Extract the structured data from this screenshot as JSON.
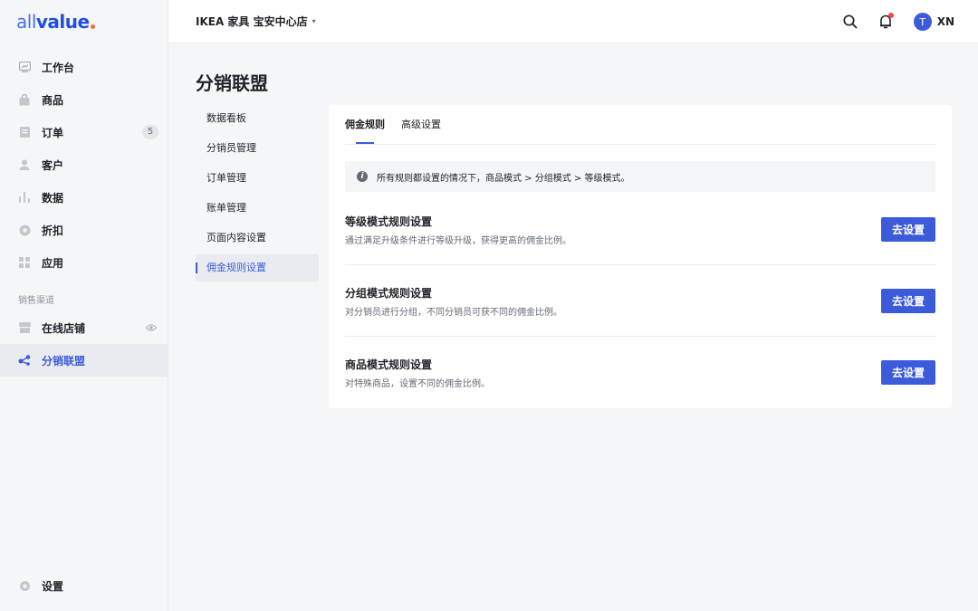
{
  "logo": {
    "part1": "all",
    "part2": "value"
  },
  "header": {
    "store_name": "IKEA 家具 宝安中心店",
    "store_caret": "▾",
    "user_initial": "T",
    "user_name": "XN"
  },
  "sidebar": {
    "items": [
      {
        "label": "工作台",
        "icon": "dashboard-icon"
      },
      {
        "label": "商品",
        "icon": "bag-icon"
      },
      {
        "label": "订单",
        "icon": "order-icon",
        "badge": "5"
      },
      {
        "label": "客户",
        "icon": "user-icon"
      },
      {
        "label": "数据",
        "icon": "chart-icon"
      },
      {
        "label": "折扣",
        "icon": "discount-icon"
      },
      {
        "label": "应用",
        "icon": "apps-icon"
      }
    ],
    "section_label": "销售渠道",
    "channels": [
      {
        "label": "在线店铺",
        "icon": "store-icon"
      },
      {
        "label": "分销联盟",
        "icon": "share-icon"
      }
    ],
    "settings_label": "设置"
  },
  "page": {
    "title": "分销联盟",
    "subnav": [
      "数据看板",
      "分销员管理",
      "订单管理",
      "账单管理",
      "页面内容设置",
      "佣金规则设置"
    ],
    "active_subnav": 5
  },
  "card": {
    "tabs": [
      "佣金规则",
      "高级设置"
    ],
    "notice": "所有规则都设置的情况下，商品模式 > 分组模式 > 等级模式。",
    "rules": [
      {
        "title": "等级模式规则设置",
        "desc": "通过满足升级条件进行等级升级，获得更高的佣金比例。",
        "button": "去设置"
      },
      {
        "title": "分组模式规则设置",
        "desc": "对分销员进行分组，不同分销员可获不同的佣金比例。",
        "button": "去设置"
      },
      {
        "title": "商品模式规则设置",
        "desc": "对特殊商品，设置不同的佣金比例。",
        "button": "去设置"
      }
    ]
  },
  "colors": {
    "accent": "#3b5bdb",
    "badge_red": "#f54a45",
    "logo_dot": "#ff6b2c"
  }
}
